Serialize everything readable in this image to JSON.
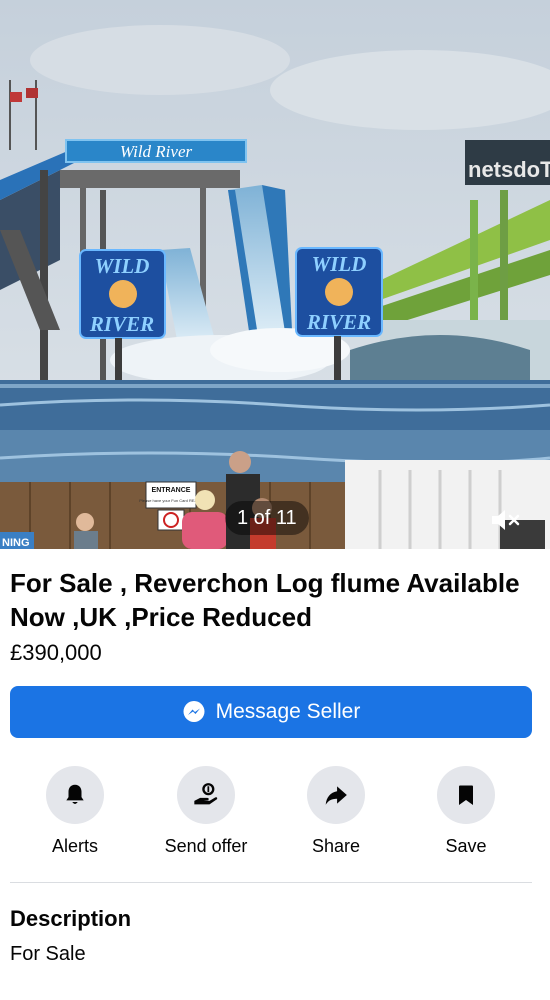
{
  "gallery": {
    "counter": "1 of 11",
    "signs": {
      "wild_river_top": "Wild River",
      "wild_river_left_1": "WILD",
      "wild_river_left_2": "RIVER",
      "wild_river_right_1": "WILD",
      "wild_river_right_2": "RIVER",
      "ride_right": "netsdoT",
      "entrance": "ENTRANCE",
      "entrance_sub": "Please have your Fun Card READY",
      "left_fragment": "NING"
    }
  },
  "listing": {
    "title": "For Sale , Reverchon Log flume Available Now ,UK ,Price Reduced",
    "price": "£390,000"
  },
  "message_button": {
    "label": "Message Seller",
    "icon": "messenger-icon"
  },
  "actions": [
    {
      "label": "Alerts",
      "icon": "bell-icon"
    },
    {
      "label": "Send offer",
      "icon": "send-offer-icon"
    },
    {
      "label": "Share",
      "icon": "share-icon"
    },
    {
      "label": "Save",
      "icon": "bookmark-icon"
    }
  ],
  "description": {
    "heading": "Description",
    "text": "For Sale"
  },
  "colors": {
    "primary": "#1b74e4",
    "action_bg": "#e4e6eb",
    "divider": "#dadde1"
  }
}
